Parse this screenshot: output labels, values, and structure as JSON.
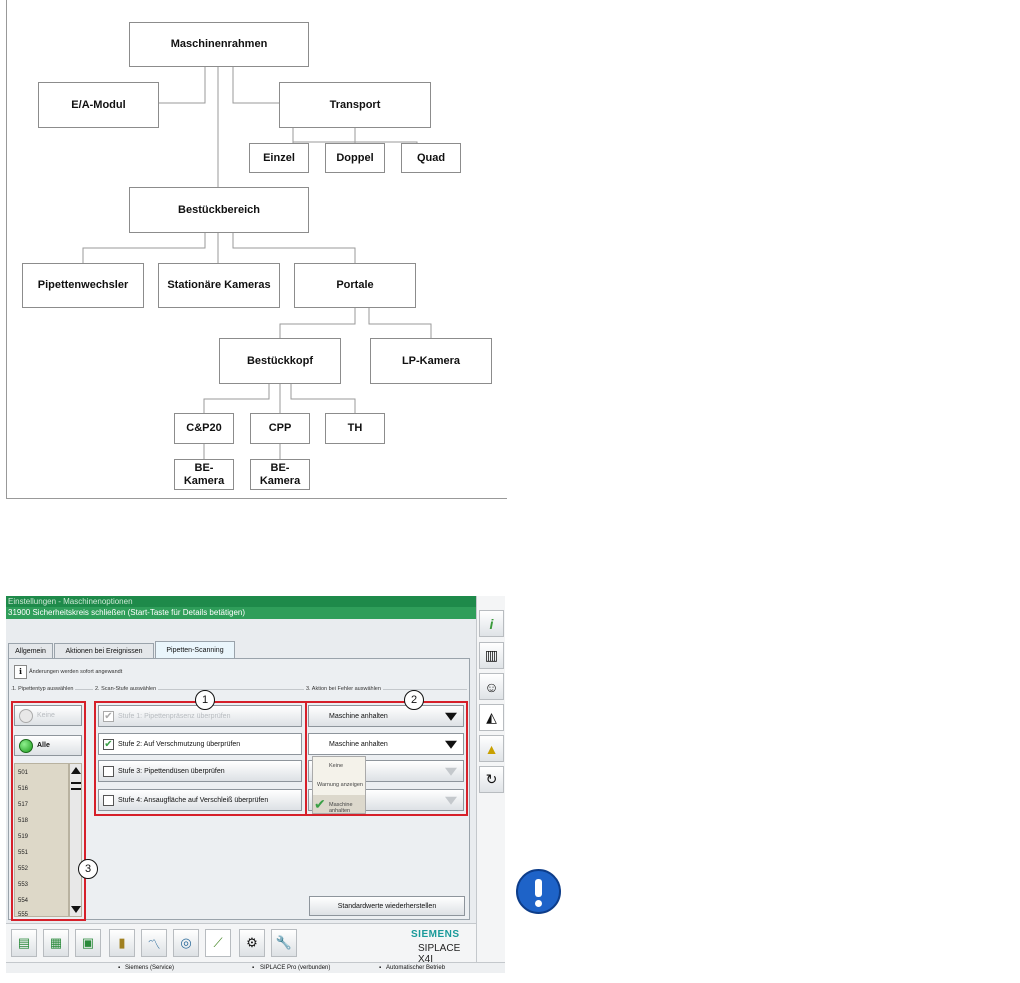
{
  "diagram": {
    "nodes": {
      "maschinenrahmen": "Maschinenrahmen",
      "ea_modul": "E/A-Modul",
      "transport": "Transport",
      "einzel": "Einzel",
      "doppel": "Doppel",
      "quad": "Quad",
      "bestueckbereich": "Bestückbereich",
      "pipettenwechsler": "Pipettenwechsler",
      "stationaere_kameras": "Stationäre Kameras",
      "portale": "Portale",
      "bestueckkopf": "Bestückkopf",
      "lp_kamera": "LP-Kamera",
      "cp20": "C&P20",
      "cpp": "CPP",
      "th": "TH",
      "be_kamera_1": "BE-Kamera",
      "be_kamera_2": "BE-Kamera"
    }
  },
  "screen": {
    "title": "Einstellungen - Maschinenoptionen",
    "status_message": "31900 Sicherheitskreis schließen (Start-Taste für Details betätigen)",
    "tabs": [
      "Allgemein",
      "Aktionen bei Ereignissen",
      "Pipetten-Scanning"
    ],
    "active_tab": "Pipetten-Scanning",
    "info_text": "Änderungen werden sofort angewandt",
    "section1_label": "1. Pipettentyp auswählen",
    "section2_label": "2. Scan-Stufe auswählen",
    "section3_label": "3. Aktion bei Fehler auswählen",
    "pipette_keine": "Keine",
    "pipette_alle": "Alle",
    "pipette_list": [
      "501",
      "516",
      "517",
      "518",
      "519",
      "551",
      "552",
      "553",
      "554",
      "555"
    ],
    "stufe1": "Stufe 1: Pipettenpräsenz überprüfen",
    "stufe2": "Stufe 2: Auf Verschmutzung überprüfen",
    "stufe3": "Stufe 3: Pipettendüsen überprüfen",
    "stufe4": "Stufe 4: Ansaugfläche auf Verschleiß überprüfen",
    "action1": "Maschine anhalten",
    "action2": "Maschine anhalten",
    "menu_options": [
      "Keine",
      "Warnung anzeigen",
      "Maschine anhalten"
    ],
    "restore_button": "Standardwerte wiederherstellen",
    "brand": "SIEMENS",
    "product": "SIPLACE X4I",
    "callouts": [
      "1",
      "2",
      "3"
    ],
    "bottom_status": [
      "Siemens (Service)",
      "SIPLACE Pro (verbunden)",
      "Automatischer Betrieb"
    ]
  },
  "colors": {
    "status_green": "#2f9e5a",
    "highlight_red": "#d6202a",
    "info_blue": "#1e63c8"
  }
}
